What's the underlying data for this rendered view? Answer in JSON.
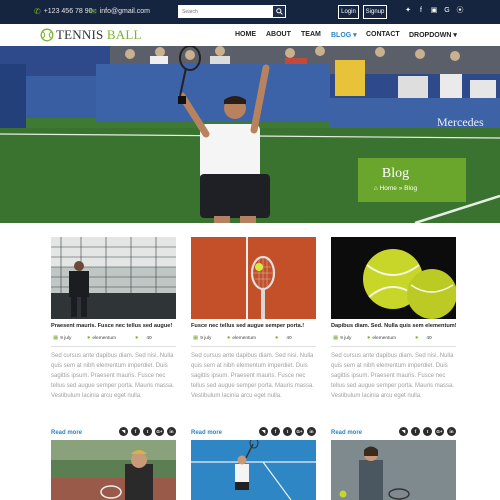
{
  "topbar": {
    "phone": "+123 456 78 90",
    "email": "info@gmail.com",
    "search_placeholder": "Search",
    "login_label": "Login",
    "signup_label": "Signup",
    "socials": [
      "twitter-icon",
      "facebook-icon",
      "instagram-icon",
      "google-icon",
      "pinterest-icon"
    ]
  },
  "brand": {
    "name_part1": "TENNIS",
    "name_part2": " BALL"
  },
  "nav": [
    {
      "label": "HOME",
      "active": false
    },
    {
      "label": "ABOUT",
      "active": false
    },
    {
      "label": "TEAM",
      "active": false
    },
    {
      "label": "BLOG ▾",
      "active": true
    },
    {
      "label": "CONTACT",
      "active": false
    },
    {
      "label": "DROPDOWN ▾",
      "active": false
    }
  ],
  "hero": {
    "title": "Blog",
    "crumb": "⌂ Home » Blog",
    "sponsor": "Mercedes"
  },
  "posts": [
    {
      "title": "Praesent mauris. Fusce nec tellus sed augue!",
      "date": "9 july",
      "author": "elementum",
      "comments": "40",
      "excerpt": "Sed cursus ante dapibus diam. Sed nisi. Nulla quis sem at nibh elementum imperdiet. Duis sagittis ipsum. Praesent mauris. Fusce nec tellus sed augue semper porta. Mauris massa. Vestibulum lacinia arcu eget nulla.",
      "read_more": "Read more"
    },
    {
      "title": "Fusce nec tellus sed augue semper porta.!",
      "date": "9 july",
      "author": "elementum",
      "comments": "40",
      "excerpt": "Sed cursus ante dapibus diam. Sed nisi. Nulla quis sem at nibh elementum imperdiet. Duis sagittis ipsum. Praesent mauris. Fusce nec tellus sed augue semper porta. Mauris massa. Vestibulum lacinia arcu eget nulla.",
      "read_more": "Read more"
    },
    {
      "title": "Dapibus diam. Sed. Nulla quis sem elementum!",
      "date": "9 july",
      "author": "elementum",
      "comments": "40",
      "excerpt": "Sed cursus ante dapibus diam. Sed nisi. Nulla quis sem at nibh elementum imperdiet. Duis sagittis ipsum. Praesent mauris. Fusce nec tellus sed augue semper porta. Mauris massa. Vestibulum lacinia arcu eget nulla.",
      "read_more": "Read more"
    }
  ],
  "share_icons": [
    {
      "icon": "rss-icon",
      "glyph": "◥"
    },
    {
      "icon": "facebook-icon",
      "glyph": "f"
    },
    {
      "icon": "twitter-icon",
      "glyph": "t"
    },
    {
      "icon": "google-plus-icon",
      "glyph": "G+"
    },
    {
      "icon": "linkedin-icon",
      "glyph": "in"
    }
  ],
  "colors": {
    "topbar": "#16253f",
    "accent_green": "#7ab52c",
    "link_blue": "#2a86c8"
  }
}
